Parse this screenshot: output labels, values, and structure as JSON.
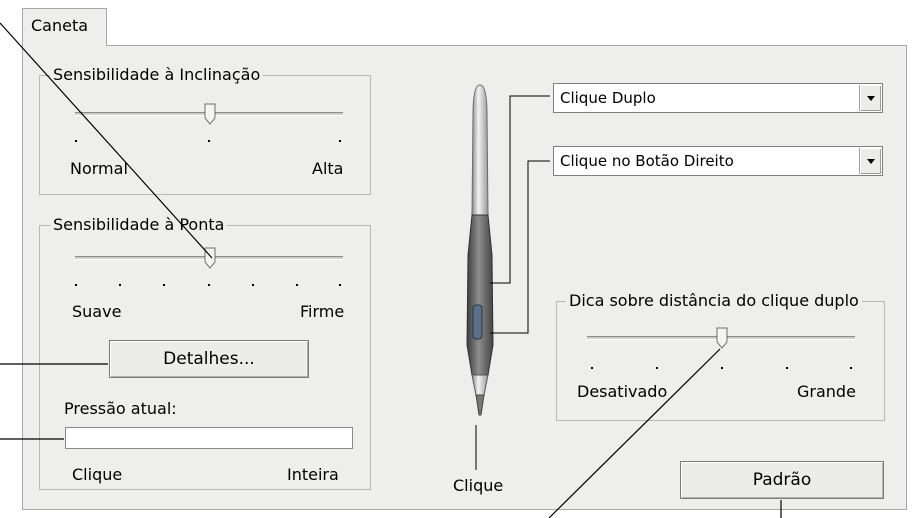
{
  "tab": {
    "label": "Caneta"
  },
  "tilt": {
    "title": "Sensibilidade à Inclinação",
    "left_label": "Normal",
    "right_label": "Alta",
    "value": 0.5
  },
  "tip": {
    "title": "Sensibilidade à Ponta",
    "left_label": "Suave",
    "right_label": "Firme",
    "value": 0.5,
    "details_button": "Detalhes...",
    "pressure_label": "Pressão atual:",
    "pressure_left": "Clique",
    "pressure_right": "Inteira"
  },
  "pen": {
    "upper_button": "Clique Duplo",
    "lower_button": "Clique no Botão Direito",
    "tip_label": "Clique"
  },
  "double_click": {
    "title": "Dica sobre distância do clique duplo",
    "left_label": "Desativado",
    "right_label": "Grande",
    "value": 0.5
  },
  "default_button": "Padrão"
}
